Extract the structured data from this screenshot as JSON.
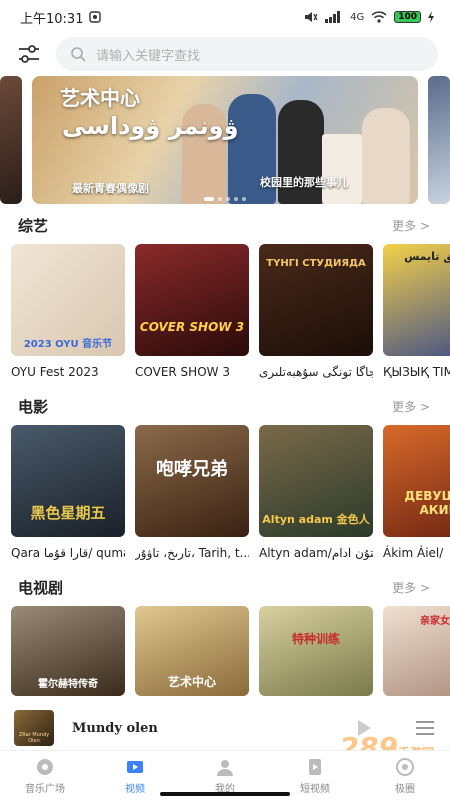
{
  "status": {
    "time": "上午10:31",
    "signal": "4G",
    "battery": "100"
  },
  "search": {
    "placeholder": "请输入关键字查找"
  },
  "banner": {
    "title": "艺术中心",
    "title_ug": "ۋونمر ۋوداسى",
    "sub1": "最新青春偶像剧",
    "sub2": "校园里的那些事儿"
  },
  "sections": [
    {
      "title": "综艺",
      "more": "更多 >",
      "items": [
        {
          "title": "OYU Fest  2023",
          "poster_text": "2023 OYU 音乐节",
          "bg": "#e8dcc8"
        },
        {
          "title": "COVER SHOW 3",
          "poster_text": "COVER SHOW 3",
          "bg": "#5a1a1a"
        },
        {
          "title": "جاگا تونگى سۇھبەتلىرى/新夜间访谈秀",
          "poster_text": "ТҮНГІ СТУДИЯДА",
          "bg": "#2a1a12"
        },
        {
          "title": "ҚЫЗЫҚ TIME",
          "poster_text": "قىزىق تايمس",
          "bg": "#3a4a8a"
        }
      ]
    },
    {
      "title": "电影",
      "more": "更多 >",
      "items": [
        {
          "title": "Qara قارا قۇما/ quma",
          "poster_text": "黑色星期五",
          "bg": "#2a3a4a"
        },
        {
          "title": "تارىخ، تاۋۇر، Tarih, t...توگكەرىس/",
          "poster_text": "咆哮兄弟",
          "bg": "#5a3a22"
        },
        {
          "title": "Altyn adam/ئالتۇن ادام",
          "poster_text": "Altyn adam 金色人",
          "bg": "#3a5a3a"
        },
        {
          "title": "Ákim Áiel/",
          "poster_text": "ДЕВУШКА АКИМ",
          "bg": "#8a3a22"
        }
      ]
    },
    {
      "title": "电视剧",
      "more": "更多 >",
      "items": [
        {
          "title": "",
          "poster_text": "霍尔赫特传奇",
          "bg": "#6a5a4a"
        },
        {
          "title": "",
          "poster_text": "艺术中心",
          "bg": "#c9a16a"
        },
        {
          "title": "",
          "poster_text": "特种训练",
          "bg": "#a8a878"
        },
        {
          "title": "",
          "poster_text": "亲家女的",
          "bg": "#c8b8a8"
        }
      ]
    }
  ],
  "player": {
    "song": "Mundy olen",
    "thumb_text": "ZRar Mundy Olen"
  },
  "tabs": [
    {
      "label": "音乐广场",
      "icon": "music-icon",
      "active": false
    },
    {
      "label": "视频",
      "icon": "video-icon",
      "active": true
    },
    {
      "label": "我的",
      "icon": "profile-icon",
      "active": false
    },
    {
      "label": "短视频",
      "icon": "short-video-icon",
      "active": false
    },
    {
      "label": "极圈",
      "icon": "circle-icon",
      "active": false
    }
  ],
  "watermark": {
    "main": "289",
    "sub": "手游网"
  },
  "colors": {
    "accent": "#3b82f6",
    "inactive": "#888888",
    "more": "#999999"
  }
}
